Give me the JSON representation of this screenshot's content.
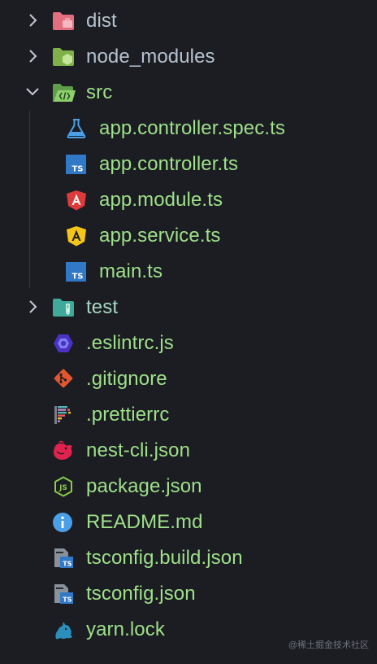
{
  "tree": {
    "items": [
      {
        "label": "dist",
        "color": "#b7c2cf"
      },
      {
        "label": "node_modules",
        "color": "#b7c2cf"
      },
      {
        "label": "src",
        "color": "#9fe08a"
      },
      {
        "label": "app.controller.spec.ts",
        "color": "#9fe08a"
      },
      {
        "label": "app.controller.ts",
        "color": "#9fe08a"
      },
      {
        "label": "app.module.ts",
        "color": "#9fe08a"
      },
      {
        "label": "app.service.ts",
        "color": "#9fe08a"
      },
      {
        "label": "main.ts",
        "color": "#9fe08a"
      },
      {
        "label": "test",
        "color": "#a8d6c3"
      },
      {
        "label": ".eslintrc.js",
        "color": "#9fe08a"
      },
      {
        "label": ".gitignore",
        "color": "#9fe08a"
      },
      {
        "label": ".prettierrc",
        "color": "#9fe08a"
      },
      {
        "label": "nest-cli.json",
        "color": "#9fe08a"
      },
      {
        "label": "package.json",
        "color": "#9fe08a"
      },
      {
        "label": "README.md",
        "color": "#9fe08a"
      },
      {
        "label": "tsconfig.build.json",
        "color": "#9fe08a"
      },
      {
        "label": "tsconfig.json",
        "color": "#9fe08a"
      },
      {
        "label": "yarn.lock",
        "color": "#9fe08a"
      }
    ]
  },
  "icons": {
    "dist": "folder-dist-icon",
    "node_modules": "folder-node-icon",
    "src": "folder-src-open-icon",
    "spec": "test-flask-icon",
    "ts": "typescript-icon",
    "angular_red": "angular-icon",
    "angular_yellow": "angular-service-icon",
    "test": "folder-test-icon",
    "eslint": "eslint-icon",
    "git": "git-icon",
    "prettier": "prettier-icon",
    "nest": "nestjs-icon",
    "nodejs": "nodejs-icon",
    "info": "info-icon",
    "tsconfig": "tsconfig-icon",
    "yarn": "yarn-icon"
  },
  "watermark": "@稀土掘金技术社区"
}
